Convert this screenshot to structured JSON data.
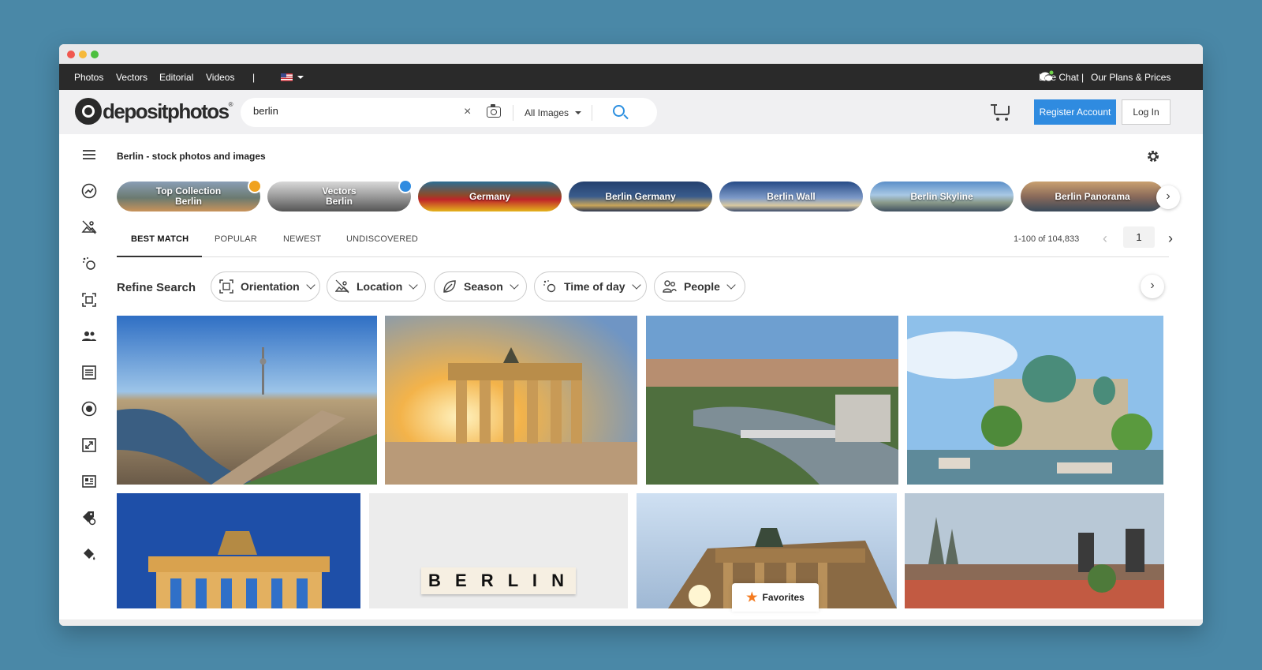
{
  "topnav": {
    "items": [
      "Photos",
      "Vectors",
      "Editorial",
      "Videos"
    ],
    "separator": "|",
    "live_chat": "Live Chat",
    "divider": "|",
    "plans": "Our Plans & Prices"
  },
  "header": {
    "logo_text": "depositphotos",
    "logo_reg": "®",
    "search_value": "berlin",
    "clear": "×",
    "scope_selected": "All Images",
    "register": "Register Account",
    "login": "Log In"
  },
  "main": {
    "title": "Berlin - stock photos and images",
    "chips": [
      {
        "line1": "Top Collection",
        "line2": "Berlin",
        "bg": "linear-gradient(180deg,#8a9eb5 0%,#6b7a70 55%,#c9935a 100%)"
      },
      {
        "line1": "Vectors",
        "line2": "Berlin",
        "bg": "linear-gradient(180deg,#d8d8d8 0%,#9a9a9a 50%,#555 100%)"
      },
      {
        "line1": "Germany",
        "line2": "",
        "bg": "linear-gradient(180deg,#2c6e93 0%,#8c4a2a 45%,#c0242a 60%,#e4b41c 100%)"
      },
      {
        "line1": "Berlin Germany",
        "line2": "",
        "bg": "linear-gradient(180deg,#24406e 0%,#3a5c8c 50%,#c9a55a 80%,#2a3550 100%)"
      },
      {
        "line1": "Berlin Wall",
        "line2": "",
        "bg": "linear-gradient(180deg,#264a86 0%,#7d9ac8 55%,#d8c8a0 80%,#3a4a6a 100%)"
      },
      {
        "line1": "Berlin Skyline",
        "line2": "",
        "bg": "linear-gradient(180deg,#5b8fc8 0%,#a8c8e4 45%,#8a9a8a 70%,#405060 100%)"
      },
      {
        "line1": "Berlin Panorama",
        "line2": "",
        "bg": "linear-gradient(180deg,#c9a070 0%,#8a6a5a 50%,#3a4a5a 100%)"
      }
    ],
    "chip_next": "›",
    "tabs": [
      "BEST MATCH",
      "POPULAR",
      "NEWEST",
      "UNDISCOVERED"
    ],
    "result_count": "1-100 of 104,833",
    "page": "1",
    "prev": "‹",
    "next": "›",
    "refine_label": "Refine Search",
    "filters": [
      "Orientation",
      "Location",
      "Season",
      "Time of day",
      "People"
    ],
    "filter_next": "›",
    "image_word": "B E R L I N",
    "favorites": "Favorites"
  },
  "colors": {
    "accent": "#2f8be0",
    "topbar": "#2a2a2a",
    "header_bg": "#f0f0f2",
    "favorite_star": "#f47a1f"
  },
  "icons": {
    "sidebar": [
      "menu-icon",
      "trending-icon",
      "collections-icon",
      "ai-icon",
      "focus-icon",
      "people-icon",
      "list-icon",
      "user-circle-icon",
      "resize-icon",
      "news-icon",
      "tag-icon",
      "paint-icon"
    ]
  }
}
